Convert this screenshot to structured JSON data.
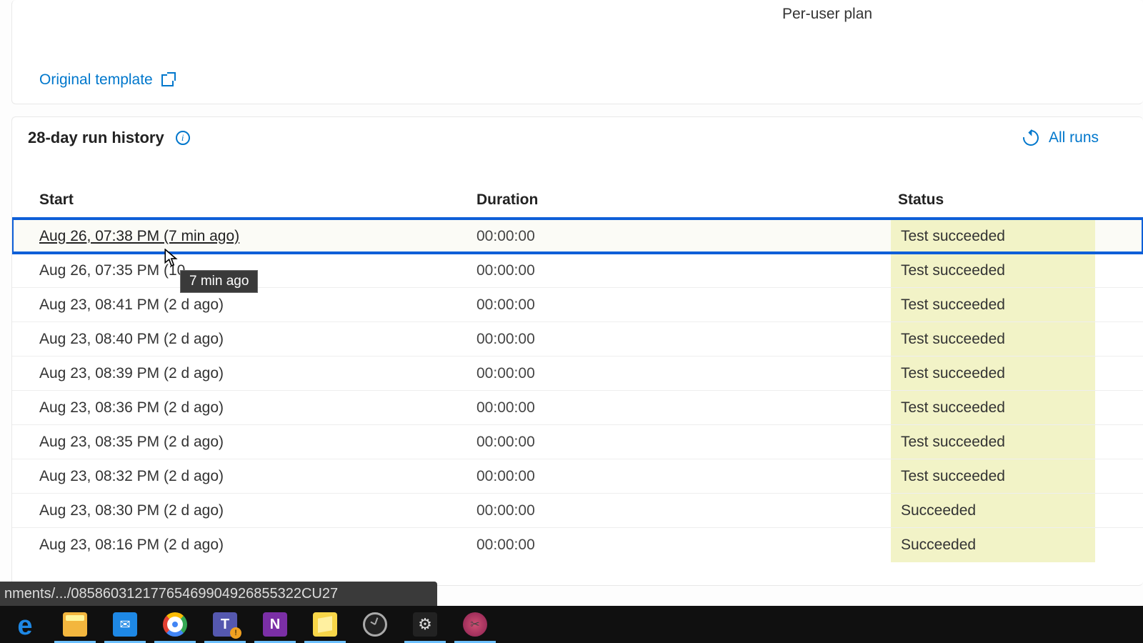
{
  "header": {
    "plan_label": "Per-user plan",
    "original_template_label": "Original template"
  },
  "history": {
    "title": "28-day run history",
    "all_runs_label": "All runs",
    "columns": {
      "start": "Start",
      "duration": "Duration",
      "status": "Status"
    },
    "rows": [
      {
        "start": "Aug 26, 07:38 PM (7 min ago)",
        "duration": "00:00:00",
        "status": "Test succeeded",
        "selected": true,
        "underline": true
      },
      {
        "start": "Aug 26, 07:35 PM (10",
        "duration": "00:00:00",
        "status": "Test succeeded"
      },
      {
        "start": "Aug 23, 08:41 PM (2 d ago)",
        "duration": "00:00:00",
        "status": "Test succeeded"
      },
      {
        "start": "Aug 23, 08:40 PM (2 d ago)",
        "duration": "00:00:00",
        "status": "Test succeeded"
      },
      {
        "start": "Aug 23, 08:39 PM (2 d ago)",
        "duration": "00:00:00",
        "status": "Test succeeded"
      },
      {
        "start": "Aug 23, 08:36 PM (2 d ago)",
        "duration": "00:00:00",
        "status": "Test succeeded"
      },
      {
        "start": "Aug 23, 08:35 PM (2 d ago)",
        "duration": "00:00:00",
        "status": "Test succeeded"
      },
      {
        "start": "Aug 23, 08:32 PM (2 d ago)",
        "duration": "00:00:00",
        "status": "Test succeeded"
      },
      {
        "start": "Aug 23, 08:30 PM (2 d ago)",
        "duration": "00:00:00",
        "status": "Succeeded"
      },
      {
        "start": "Aug 23, 08:16 PM (2 d ago)",
        "duration": "00:00:00",
        "status": "Succeeded"
      }
    ],
    "tooltip": "7 min ago"
  },
  "status_bar": "nments/.../08586031217765469904926855322CU27",
  "taskbar_icons": [
    "edge",
    "file-explorer",
    "mail",
    "chrome",
    "teams",
    "onenote",
    "sticky-notes",
    "clock",
    "settings",
    "snip"
  ]
}
